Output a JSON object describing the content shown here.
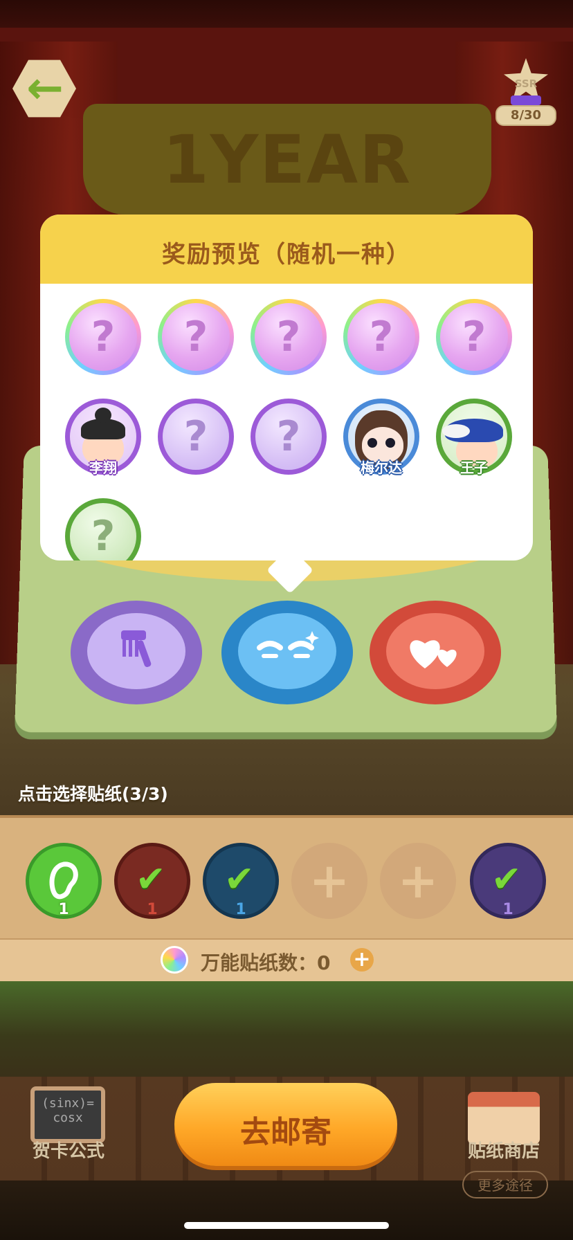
{
  "header": {
    "rank_label": "SSR",
    "rank_progress": "8/30",
    "banner_text": "1YEAR"
  },
  "popup": {
    "title": "奖励预览（随机一种）",
    "rewards": [
      {
        "type": "unknown",
        "frame": "rainbow",
        "name": ""
      },
      {
        "type": "unknown",
        "frame": "rainbow",
        "name": ""
      },
      {
        "type": "unknown",
        "frame": "rainbow",
        "name": ""
      },
      {
        "type": "unknown",
        "frame": "rainbow",
        "name": ""
      },
      {
        "type": "unknown",
        "frame": "rainbow",
        "name": ""
      },
      {
        "type": "character",
        "frame": "purple",
        "name": "李翔"
      },
      {
        "type": "unknown",
        "frame": "purple",
        "name": ""
      },
      {
        "type": "unknown",
        "frame": "purple",
        "name": ""
      },
      {
        "type": "character",
        "frame": "blue",
        "name": "梅尔达"
      },
      {
        "type": "character",
        "frame": "green",
        "name": "王子"
      },
      {
        "type": "unknown",
        "frame": "green",
        "name": ""
      }
    ],
    "question_mark": "?"
  },
  "sticker_buttons": [
    {
      "icon": "comb-icon",
      "color": "#a98ae6"
    },
    {
      "icon": "smiling-eyes-icon",
      "color": "#4aa6e6"
    },
    {
      "icon": "hearts-icon",
      "color": "#e65a4a"
    }
  ],
  "select_label": "点击选择贴纸(3/3)",
  "tray": {
    "slots": [
      {
        "state": "ear",
        "count": "1",
        "color": "#5ac83a"
      },
      {
        "state": "checked",
        "count": "1",
        "color": "#7a2a22"
      },
      {
        "state": "checked",
        "count": "1",
        "color": "#1e4a6a"
      },
      {
        "state": "empty",
        "count": "",
        "color": "#d2a87a"
      },
      {
        "state": "empty",
        "count": "",
        "color": "#d2a87a"
      },
      {
        "state": "checked",
        "count": "1",
        "color": "#4a3a7a"
      }
    ],
    "check_mark": "✔",
    "plus_mark": "+",
    "universal_label": "万能贴纸数：",
    "universal_count": "0",
    "universal_plus": "+"
  },
  "bottom": {
    "card_formula_text": "(sinx)=\ncosx",
    "card_label": "贺卡公式",
    "go_button": "去邮寄",
    "shop_label": "贴纸商店",
    "more_button": "更多途径"
  }
}
